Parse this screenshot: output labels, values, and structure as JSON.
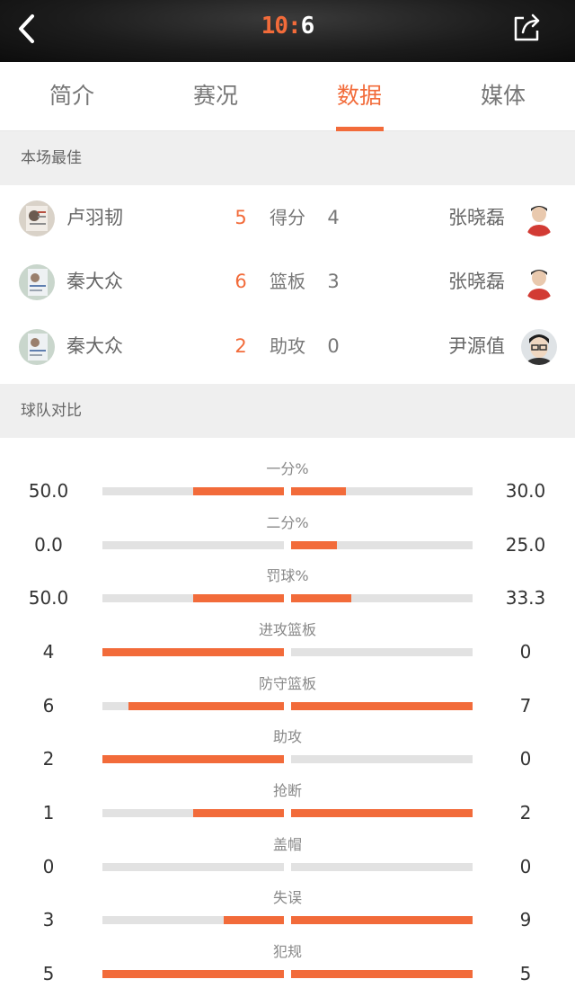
{
  "header": {
    "score_home": "10",
    "score_sep": ":",
    "score_away": "6",
    "back_icon": "back-chevron-icon",
    "share_icon": "share-icon"
  },
  "tabs": [
    {
      "label": "简介"
    },
    {
      "label": "赛况"
    },
    {
      "label": "数据",
      "active": true
    },
    {
      "label": "媒体"
    }
  ],
  "best": {
    "title": "本场最佳",
    "rows": [
      {
        "home_player": "卢羽韧",
        "home_value": "5",
        "label": "得分",
        "away_value": "4",
        "away_player": "张晓磊"
      },
      {
        "home_player": "秦大众",
        "home_value": "6",
        "label": "篮板",
        "away_value": "3",
        "away_player": "张晓磊"
      },
      {
        "home_player": "秦大众",
        "home_value": "2",
        "label": "助攻",
        "away_value": "0",
        "away_player": "尹源值"
      }
    ]
  },
  "compare": {
    "title": "球队对比",
    "rows": [
      {
        "label": "一分%",
        "left": "50.0",
        "right": "30.0",
        "left_ratio": 0.5,
        "right_ratio": 0.3
      },
      {
        "label": "二分%",
        "left": "0.0",
        "right": "25.0",
        "left_ratio": 0.0,
        "right_ratio": 0.25
      },
      {
        "label": "罚球%",
        "left": "50.0",
        "right": "33.3",
        "left_ratio": 0.5,
        "right_ratio": 0.333
      },
      {
        "label": "进攻篮板",
        "left": "4",
        "right": "0",
        "left_ratio": 1.0,
        "right_ratio": 0.0
      },
      {
        "label": "防守篮板",
        "left": "6",
        "right": "7",
        "left_ratio": 0.857,
        "right_ratio": 1.0
      },
      {
        "label": "助攻",
        "left": "2",
        "right": "0",
        "left_ratio": 1.0,
        "right_ratio": 0.0
      },
      {
        "label": "抢断",
        "left": "1",
        "right": "2",
        "left_ratio": 0.5,
        "right_ratio": 1.0
      },
      {
        "label": "盖帽",
        "left": "0",
        "right": "0",
        "left_ratio": 0.0,
        "right_ratio": 0.0
      },
      {
        "label": "失误",
        "left": "3",
        "right": "9",
        "left_ratio": 0.333,
        "right_ratio": 1.0
      },
      {
        "label": "犯规",
        "left": "5",
        "right": "5",
        "left_ratio": 1.0,
        "right_ratio": 1.0
      }
    ]
  },
  "colors": {
    "accent": "#f26b3a",
    "track": "#e2e2e2",
    "section_bg": "#efefef"
  }
}
